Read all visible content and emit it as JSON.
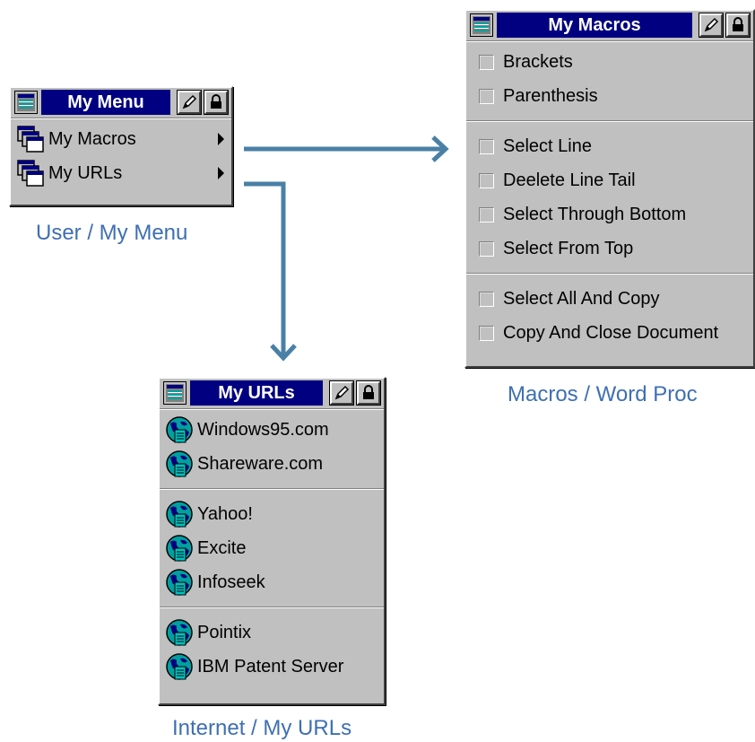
{
  "colors": {
    "arrow": "#4a80a6",
    "titlebar": "#000080",
    "caption": "#3e6fb3"
  },
  "my_menu": {
    "title": "My Menu",
    "icons": {
      "system": "toolbar-icon",
      "edit": "pencil-icon",
      "lock": "lock-icon"
    },
    "items": [
      {
        "label": "My Macros",
        "icon": "window-stack-icon",
        "submenu": true
      },
      {
        "label": "My URLs",
        "icon": "window-stack-icon",
        "submenu": true
      }
    ],
    "caption": "User / My Menu"
  },
  "my_macros": {
    "title": "My Macros",
    "groups": [
      [
        {
          "label": "Brackets"
        },
        {
          "label": "Parenthesis"
        }
      ],
      [
        {
          "label": "Select Line"
        },
        {
          "label": "Deelete Line Tail"
        },
        {
          "label": "Select Through Bottom"
        },
        {
          "label": "Select From Top"
        }
      ],
      [
        {
          "label": "Select All And Copy"
        },
        {
          "label": "Copy And Close Document"
        }
      ]
    ],
    "caption": "Macros / Word Proc"
  },
  "my_urls": {
    "title": "My URLs",
    "groups": [
      [
        {
          "label": "Windows95.com",
          "icon": "globe-icon"
        },
        {
          "label": "Shareware.com",
          "icon": "globe-icon"
        }
      ],
      [
        {
          "label": "Yahoo!",
          "icon": "globe-icon"
        },
        {
          "label": "Excite",
          "icon": "globe-icon"
        },
        {
          "label": "Infoseek",
          "icon": "globe-icon"
        }
      ],
      [
        {
          "label": "Pointix",
          "icon": "globe-icon"
        },
        {
          "label": "IBM Patent Server",
          "icon": "globe-icon"
        }
      ]
    ],
    "caption": "Internet / My URLs"
  }
}
